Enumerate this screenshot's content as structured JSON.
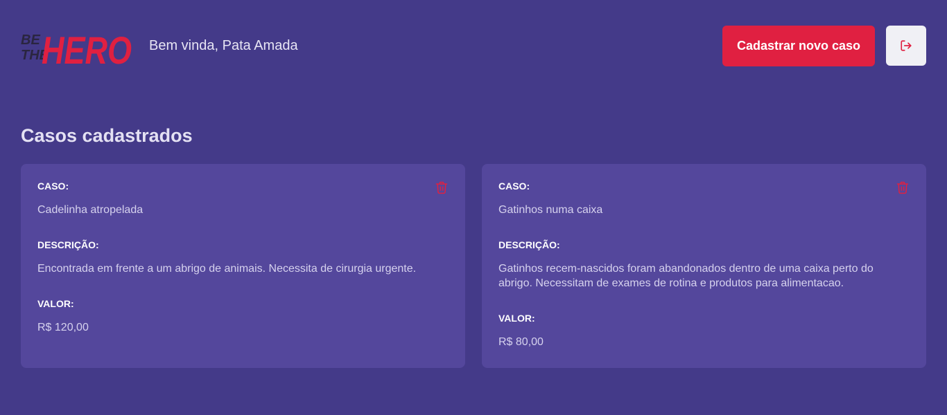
{
  "header": {
    "logo_text_top": "BE",
    "logo_text_mid": "THE",
    "logo_text_main": "HERO",
    "greeting": "Bem vinda, Pata Amada",
    "new_case_button": "Cadastrar novo caso",
    "logout_icon": "logout-icon"
  },
  "page_title": "Casos cadastrados",
  "colors": {
    "background": "#443a89",
    "card": "#54479c",
    "accent": "#e02041",
    "logout_bg": "#f0f0f5"
  },
  "cases": [
    {
      "case_label": "CASO:",
      "case_value": "Cadelinha atropelada",
      "description_label": "DESCRIÇÃO:",
      "description_value": "Encontrada em frente a um abrigo de animais. Necessita de cirurgia urgente.",
      "value_label": "VALOR:",
      "value_value": "R$ 120,00"
    },
    {
      "case_label": "CASO:",
      "case_value": "Gatinhos numa caixa",
      "description_label": "DESCRIÇÃO:",
      "description_value": "Gatinhos recem-nascidos foram abandonados dentro de uma caixa perto do abrigo. Necessitam de exames de rotina e produtos para alimentacao.",
      "value_label": "VALOR:",
      "value_value": "R$ 80,00"
    }
  ]
}
